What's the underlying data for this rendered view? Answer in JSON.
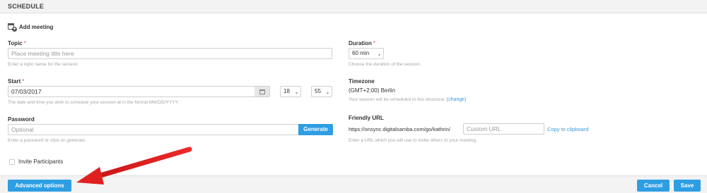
{
  "header": {
    "title": "SCHEDULE"
  },
  "add_meeting": {
    "icon": "calendar-add-icon",
    "label": "Add meeting"
  },
  "topic": {
    "label": "Topic",
    "required_mark": "*",
    "placeholder": "Place meeting title here",
    "help": "Enter a topic name for the session."
  },
  "start": {
    "label": "Start",
    "required_mark": "*",
    "date_value": "07/03/2017",
    "hour": "18",
    "minute": "55",
    "help": "The date and time you wish to schedule your session at in the format MM/DD/YYYY."
  },
  "password": {
    "label": "Password",
    "placeholder": "Optional",
    "generate_label": "Generate",
    "help": "Enter a password or click on generate."
  },
  "invite": {
    "label": "Invite Participants",
    "checked": false
  },
  "duration": {
    "label": "Duration",
    "required_mark": "*",
    "value": "60 min",
    "help": "Choose the duration of the session."
  },
  "timezone": {
    "label": "Timezone",
    "value": "(GMT+2:00) Berlin",
    "help": "Your session will be scheduled in this timezone.",
    "change_label": "(change)"
  },
  "friendly_url": {
    "label": "Friendly URL",
    "prefix": "https://onsync.digitalsamba.com/go/kathrin/",
    "placeholder": "Custom URL",
    "copy_label": "Copy to clipboard",
    "help": "Enter a URL which you will use to invite others to your meeting."
  },
  "footer": {
    "advanced_label": "Advanced options",
    "cancel_label": "Cancel",
    "save_label": "Save"
  },
  "colors": {
    "accent": "#2e9ee3",
    "arrow": "#e02020",
    "required": "#e24a4a"
  }
}
